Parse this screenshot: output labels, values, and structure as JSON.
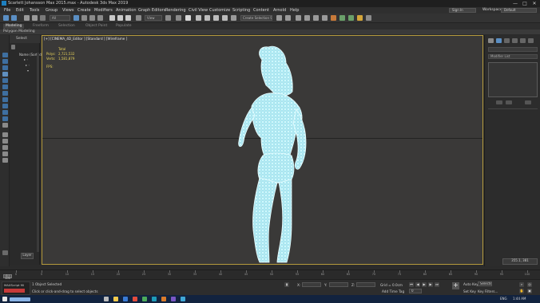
{
  "window": {
    "title": "Scarlett Johansson Max 2015.max - Autodesk 3ds Max 2019",
    "controls": [
      "—",
      "□",
      "✕"
    ]
  },
  "menu": {
    "items": [
      "File",
      "Edit",
      "Tools",
      "Group",
      "Views",
      "Create",
      "Modifiers",
      "Animation",
      "Graph Editors",
      "Rendering",
      "Civil View",
      "Customize",
      "Scripting",
      "Content",
      "Arnold",
      "Help"
    ],
    "signin": "Sign In",
    "workspaces_label": "Workspaces:",
    "workspace_value": "Default"
  },
  "toolbar": {
    "layer_dropdown": "All",
    "view_dropdown": "View",
    "selection_set": "Create Selection Se"
  },
  "ribbon": {
    "tabs": [
      "Modeling",
      "Freeform",
      "Selection",
      "Object Paint",
      "Populate"
    ],
    "panel": "Polygon Modeling"
  },
  "explorer": {
    "header": "Select",
    "column": "Name (Sorted",
    "footer": "Layer"
  },
  "viewport": {
    "label": "[+] [CINEMA_4D_Editor ] [Standard ] [Wireframe ]",
    "stats": {
      "total_label": "Total",
      "polys_label": "Polys:",
      "polys_value": "2,721,532",
      "verts_label": "Verts:",
      "verts_value": "1,581,879",
      "fps_label": "FPS:"
    }
  },
  "command_panel": {
    "modifier_list": "Modifier List",
    "coords": "355.1, 381"
  },
  "timeline": {
    "slider": "0 / 100",
    "ticks": [
      "0",
      "5",
      "10",
      "15",
      "20",
      "25",
      "30",
      "35",
      "40",
      "45",
      "50",
      "55",
      "60",
      "65",
      "70",
      "75",
      "80",
      "85",
      "90",
      "95",
      "100"
    ]
  },
  "status": {
    "maxscript": "MAXScript Mi",
    "selected": "1 Object Selected",
    "prompt": "Click or click-and-drag to select objects",
    "x_label": "X:",
    "y_label": "Y:",
    "z_label": "Z:",
    "grid": "Grid = 0.0cm",
    "add_time_tag": "Add Time Tag",
    "auto_key": "Auto Key",
    "set_key": "Set Key",
    "selected_dd": "Selected",
    "key_filters": "Key Filters...",
    "frame": "0"
  },
  "taskbar": {
    "lang": "ENG",
    "time": "1:44 AM"
  },
  "colors": {
    "wireframe": "#bff6ff",
    "viewport_bg": "#3a3938",
    "active_border": "#b59a3c",
    "stats": "#e8d35a"
  }
}
